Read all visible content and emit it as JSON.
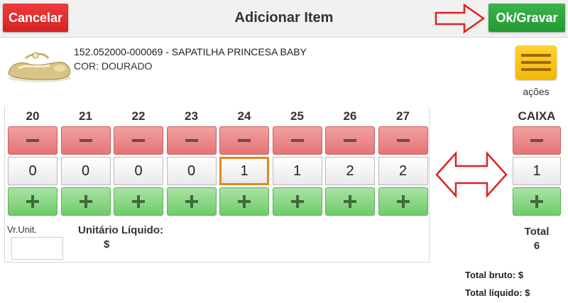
{
  "header": {
    "title": "Adicionar Item",
    "cancel_label": "Cancelar",
    "ok_label": "Ok/Gravar"
  },
  "product": {
    "code_line": "152.052000-000069 - SAPATILHA PRINCESA BABY",
    "color_line": "COR: DOURADO",
    "image_icon": "golden-shoe-image"
  },
  "actions": {
    "label": "ações",
    "icon": "menu-icon"
  },
  "sizes": [
    {
      "size": "20",
      "qty": "0"
    },
    {
      "size": "21",
      "qty": "0"
    },
    {
      "size": "22",
      "qty": "0"
    },
    {
      "size": "23",
      "qty": "0"
    },
    {
      "size": "24",
      "qty": "1"
    },
    {
      "size": "25",
      "qty": "1"
    },
    {
      "size": "26",
      "qty": "2"
    },
    {
      "size": "27",
      "qty": "2"
    }
  ],
  "pricing": {
    "vr_unit_label": "Vr.Unit.",
    "vr_unit_value": "",
    "unit_liquid_label": "Unitário Líquido:",
    "unit_liquid_value": "$"
  },
  "box": {
    "label": "CAIXA",
    "qty": "1"
  },
  "totals": {
    "total_label": "Total",
    "total_value": "6",
    "gross_label": "Total bruto: $",
    "net_label": "Total liquido: $"
  },
  "colors": {
    "cancel": "#d42222",
    "ok": "#249a34",
    "minus": "#e57575",
    "plus": "#6fcc6a",
    "selected": "#e08a1e",
    "actions": "#f2b705",
    "annotation_arrow": "#e02020"
  }
}
